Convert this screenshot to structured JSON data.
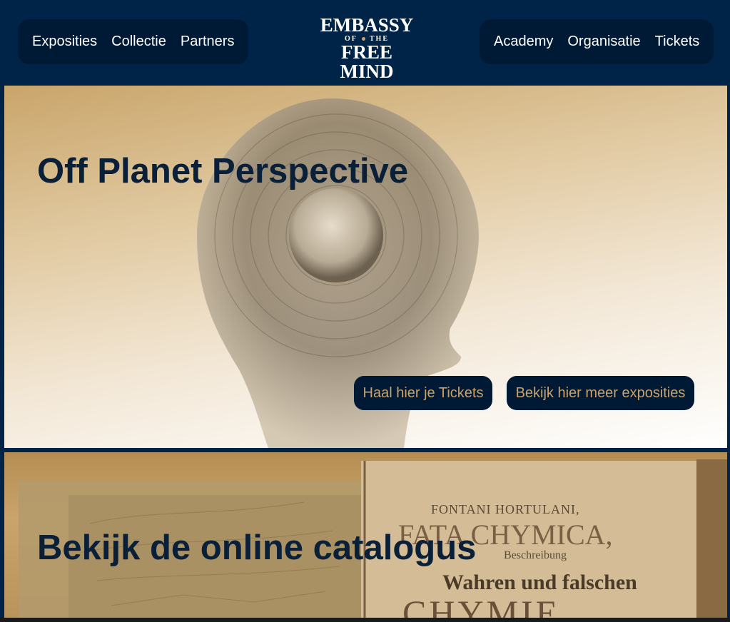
{
  "nav": {
    "left": [
      "Exposities",
      "Collectie",
      "Partners"
    ],
    "right": [
      "Academy",
      "Organisatie",
      "Tickets"
    ]
  },
  "logo": {
    "top": "EMBASSY",
    "mid_left": "OF",
    "mid_right": "THE",
    "bottom": "FREE MIND"
  },
  "hero": {
    "title": "Off Planet Perspective",
    "cta_tickets": "Haal hier je Tickets",
    "cta_exhibitions": "Bekijk hier meer exposities"
  },
  "catalog": {
    "title": "Bekijk de online catalogus",
    "book_line1": "FONTANI HORTULANI,",
    "book_line2": "FATA CHYMICA,",
    "book_line3": "Beschreibung",
    "book_line4": "Wahren und falschen",
    "book_line5": "CHYMIE"
  },
  "colors": {
    "navy": "#002447",
    "pill": "#001a35",
    "gold": "#c9a26b",
    "title": "#0a1f38"
  }
}
